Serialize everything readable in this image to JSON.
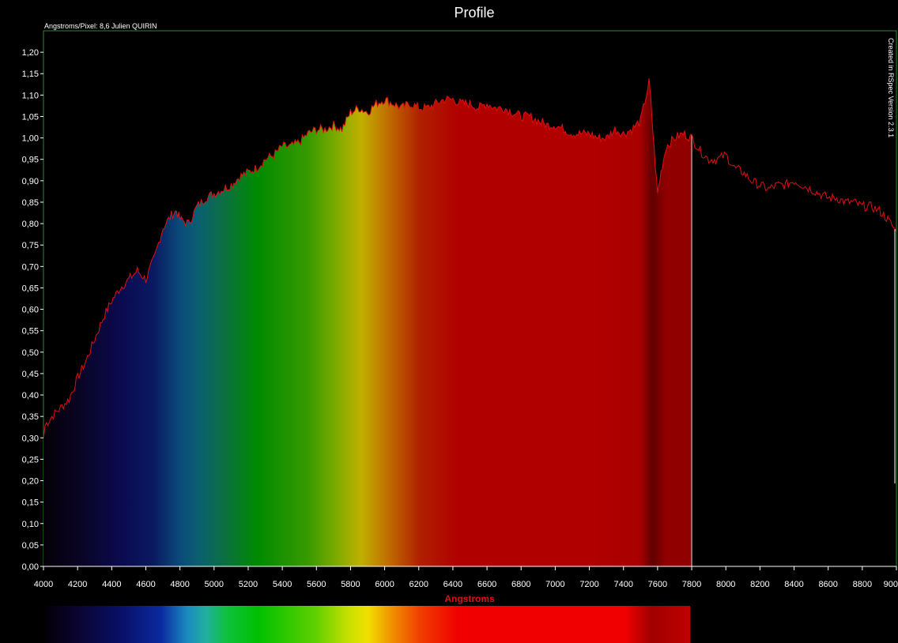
{
  "window": {
    "title": "Profile"
  },
  "header": {
    "info": "Angstroms/Pixel: 8,6 Julien QUIRIN"
  },
  "side_note": "Created in RSpec Version 2.3.1",
  "colors": {
    "profile_line": "#e01010",
    "axis_label": "#e01010",
    "plot_frame": "#2a8a2a",
    "background": "#000000"
  },
  "chart_data": {
    "type": "area",
    "title": "Profile",
    "xlabel": "Angstroms",
    "ylabel": "",
    "xlim": [
      4000,
      9000
    ],
    "ylim": [
      0,
      1.25
    ],
    "grid": false,
    "colored_fill_range": [
      4000,
      7800
    ],
    "x_tick_labels": [
      "4000",
      "4200",
      "4400",
      "4600",
      "4800",
      "5000",
      "5200",
      "5400",
      "5600",
      "5800",
      "6000",
      "6200",
      "6400",
      "6600",
      "6800",
      "7000",
      "7200",
      "7400",
      "7600",
      "7800",
      "8000",
      "8200",
      "8400",
      "8600",
      "8800",
      "900"
    ],
    "y_tick_labels": [
      "0,00",
      "0,05",
      "0,10",
      "0,15",
      "0,20",
      "0,25",
      "0,30",
      "0,35",
      "0,40",
      "0,45",
      "0,50",
      "0,55",
      "0,60",
      "0,65",
      "0,70",
      "0,75",
      "0,80",
      "0,85",
      "0,90",
      "0,95",
      "1,00",
      "1,05",
      "1,10",
      "1,15",
      "1,20"
    ],
    "series": [
      {
        "x": [
          4000,
          4010,
          4050,
          4100,
          4150,
          4200,
          4250,
          4300,
          4350,
          4400,
          4450,
          4500,
          4550,
          4600,
          4650,
          4700,
          4750,
          4780,
          4800,
          4850,
          4900,
          4950,
          5000,
          5050,
          5100,
          5150,
          5200,
          5250,
          5300,
          5350,
          5400,
          5450,
          5500,
          5550,
          5600,
          5650,
          5700,
          5750,
          5800,
          5850,
          5900,
          5950,
          6000,
          6050,
          6100,
          6150,
          6200,
          6250,
          6300,
          6350,
          6400,
          6450,
          6500,
          6550,
          6600,
          6650,
          6700,
          6750,
          6800,
          6850,
          6900,
          6950,
          7000,
          7050,
          7100,
          7150,
          7200,
          7250,
          7300,
          7350,
          7400,
          7450,
          7500,
          7550,
          7560,
          7580,
          7600,
          7620,
          7650,
          7700,
          7750,
          7800,
          7850,
          7900,
          7950,
          8000,
          8050,
          8100,
          8150,
          8200,
          8250,
          8300,
          8350,
          8400,
          8450,
          8500,
          8550,
          8600,
          8650,
          8700,
          8750,
          8800,
          8850,
          8900,
          8950,
          9000
        ],
        "y": [
          0.3,
          0.33,
          0.35,
          0.37,
          0.39,
          0.44,
          0.48,
          0.53,
          0.58,
          0.62,
          0.65,
          0.67,
          0.69,
          0.67,
          0.72,
          0.79,
          0.82,
          0.83,
          0.81,
          0.8,
          0.84,
          0.86,
          0.87,
          0.88,
          0.89,
          0.91,
          0.92,
          0.93,
          0.95,
          0.96,
          0.98,
          0.98,
          0.99,
          1.01,
          1.02,
          1.02,
          1.03,
          1.02,
          1.06,
          1.07,
          1.06,
          1.08,
          1.09,
          1.08,
          1.07,
          1.08,
          1.07,
          1.07,
          1.08,
          1.09,
          1.09,
          1.08,
          1.08,
          1.07,
          1.08,
          1.07,
          1.07,
          1.06,
          1.05,
          1.05,
          1.04,
          1.03,
          1.03,
          1.02,
          1.01,
          1.01,
          1.01,
          1.0,
          1.0,
          1.02,
          1.01,
          1.02,
          1.04,
          1.13,
          1.09,
          0.97,
          0.87,
          0.92,
          0.98,
          1.0,
          1.01,
          1.0,
          0.97,
          0.95,
          0.95,
          0.96,
          0.93,
          0.92,
          0.9,
          0.89,
          0.88,
          0.89,
          0.89,
          0.9,
          0.89,
          0.88,
          0.87,
          0.86,
          0.86,
          0.85,
          0.85,
          0.84,
          0.84,
          0.83,
          0.81,
          0.78
        ]
      }
    ]
  }
}
